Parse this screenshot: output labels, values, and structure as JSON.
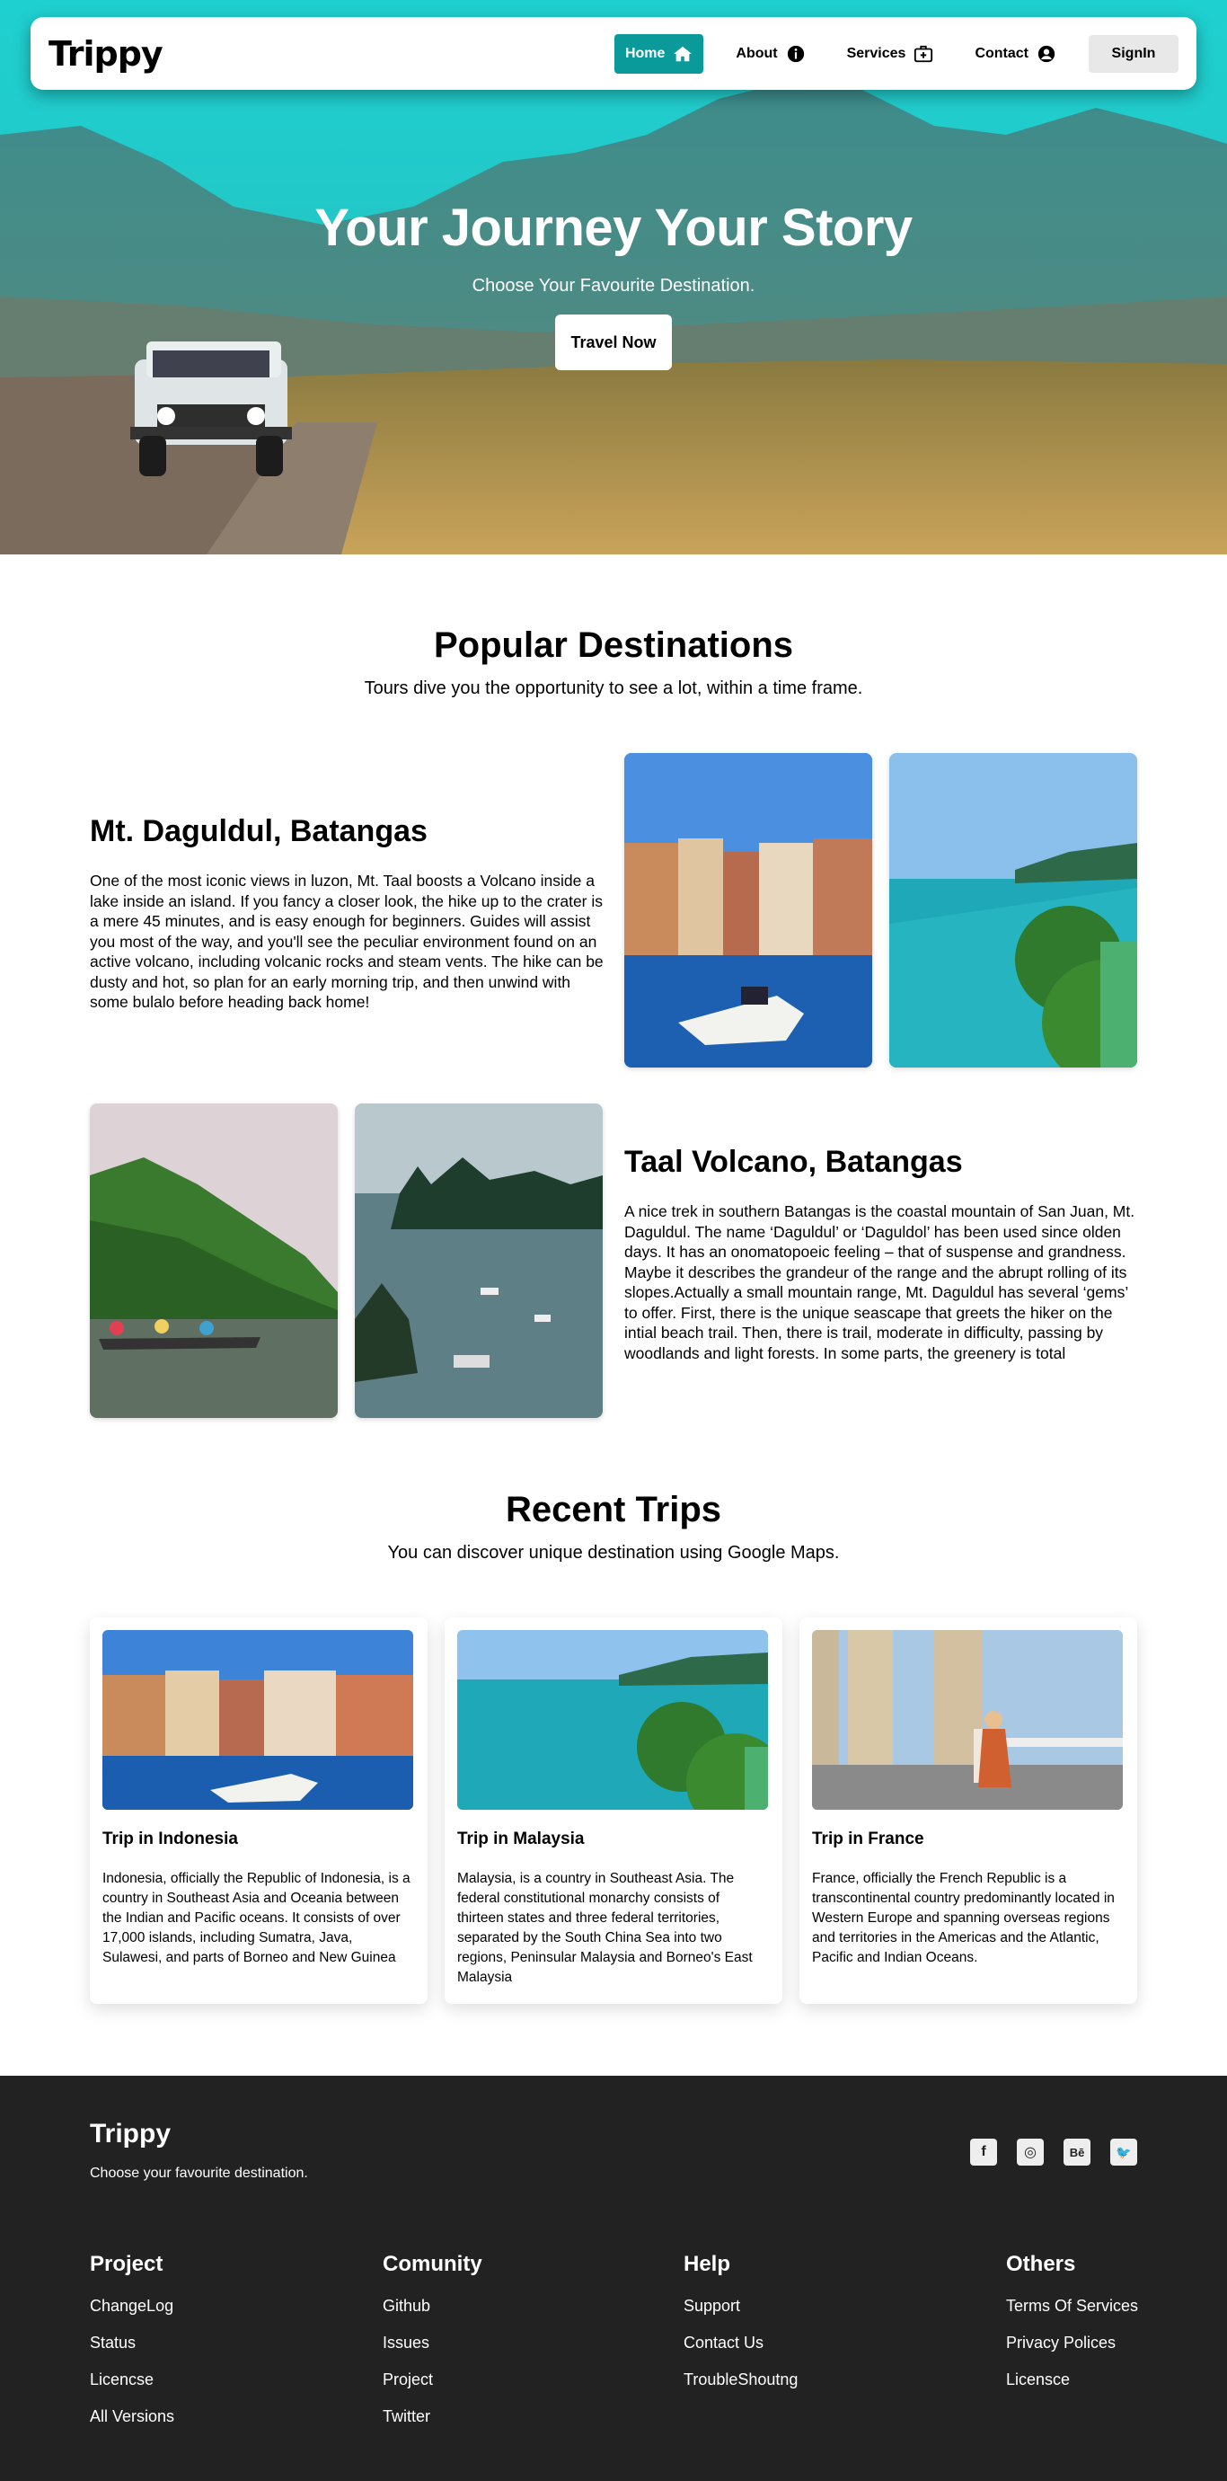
{
  "nav": {
    "logo": "Trippy",
    "items": [
      {
        "label": "Home",
        "icon": "home-icon"
      },
      {
        "label": "About",
        "icon": "info-icon"
      },
      {
        "label": "Services",
        "icon": "first-aid-icon"
      },
      {
        "label": "Contact",
        "icon": "user-circle-icon"
      }
    ],
    "signin": "SignIn"
  },
  "hero": {
    "title": "Your Journey Your Story",
    "subtitle": "Choose Your Favourite Destination.",
    "button": "Travel Now"
  },
  "popular": {
    "title": "Popular Destinations",
    "subtitle": "Tours dive you the opportunity to see a lot, within a time frame.",
    "items": [
      {
        "title": "Mt. Daguldul, Batangas",
        "text": "One of the most iconic views in luzon, Mt. Taal boosts a Volcano inside a lake inside an island. If you fancy a closer look, the hike up to the crater is a mere 45 minutes, and is easy enough for beginners. Guides will assist you most of the way, and you'll see the peculiar environment found on an active volcano, including volcanic rocks and steam vents. The hike can be dusty and hot, so plan for an early morning trip, and then unwind with some bulalo before heading back home!"
      },
      {
        "title": "Taal Volcano, Batangas",
        "text": "A nice trek in southern Batangas is the coastal mountain of San Juan, Mt. Daguldul. The name ‘Daguldul’ or ‘Daguldol’ has been used since olden days. It has an onomatopoeic feeling – that of suspense and grandness. Maybe it describes the grandeur of the range and the abrupt rolling of its slopes.Actually a small mountain range, Mt. Daguldul has several ‘gems’ to offer. First, there is the unique seascape that greets the hiker on the intial beach trail. Then, there is trail, moderate in difficulty, passing by woodlands and light forests. In some parts, the greenery is total"
      }
    ]
  },
  "recent": {
    "title": "Recent Trips",
    "subtitle": "You can discover unique destination using Google Maps.",
    "cards": [
      {
        "title": "Trip in Indonesia",
        "text": "Indonesia, officially the Republic of Indonesia, is a country in Southeast Asia and Oceania between the Indian and Pacific oceans. It consists of over 17,000 islands, including Sumatra, Java, Sulawesi, and parts of Borneo and New Guinea"
      },
      {
        "title": "Trip in Malaysia",
        "text": "Malaysia, is a country in Southeast Asia. The federal constitutional monarchy consists of thirteen states and three federal territories, separated by the South China Sea into two regions, Peninsular Malaysia and Borneo's East Malaysia"
      },
      {
        "title": "Trip in France",
        "text": "France, officially the French Republic is a transcontinental country predominantly located in Western Europe and spanning overseas regions and territories in the Americas and the Atlantic, Pacific and Indian Oceans."
      }
    ]
  },
  "footer": {
    "logo": "Trippy",
    "tagline": "Choose your favourite destination.",
    "social": [
      {
        "icon": "facebook-icon",
        "glyph": "f"
      },
      {
        "icon": "instagram-icon",
        "glyph": "◎"
      },
      {
        "icon": "behance-icon",
        "glyph": "Bē"
      },
      {
        "icon": "twitter-icon",
        "glyph": "🐦"
      }
    ],
    "columns": [
      {
        "title": "Project",
        "links": [
          "ChangeLog",
          "Status",
          "Licencse",
          "All Versions"
        ]
      },
      {
        "title": "Comunity",
        "links": [
          "Github",
          "Issues",
          "Project",
          "Twitter"
        ]
      },
      {
        "title": "Help",
        "links": [
          "Support",
          "Contact Us",
          "TroubleShoutng"
        ]
      },
      {
        "title": "Others",
        "links": [
          "Terms Of Services",
          "Privacy Polices",
          "Licensce"
        ]
      }
    ]
  },
  "colors": {
    "accent": "#0b9a9a",
    "footer_bg": "#222222",
    "hero_sky": "#12c4c4"
  }
}
